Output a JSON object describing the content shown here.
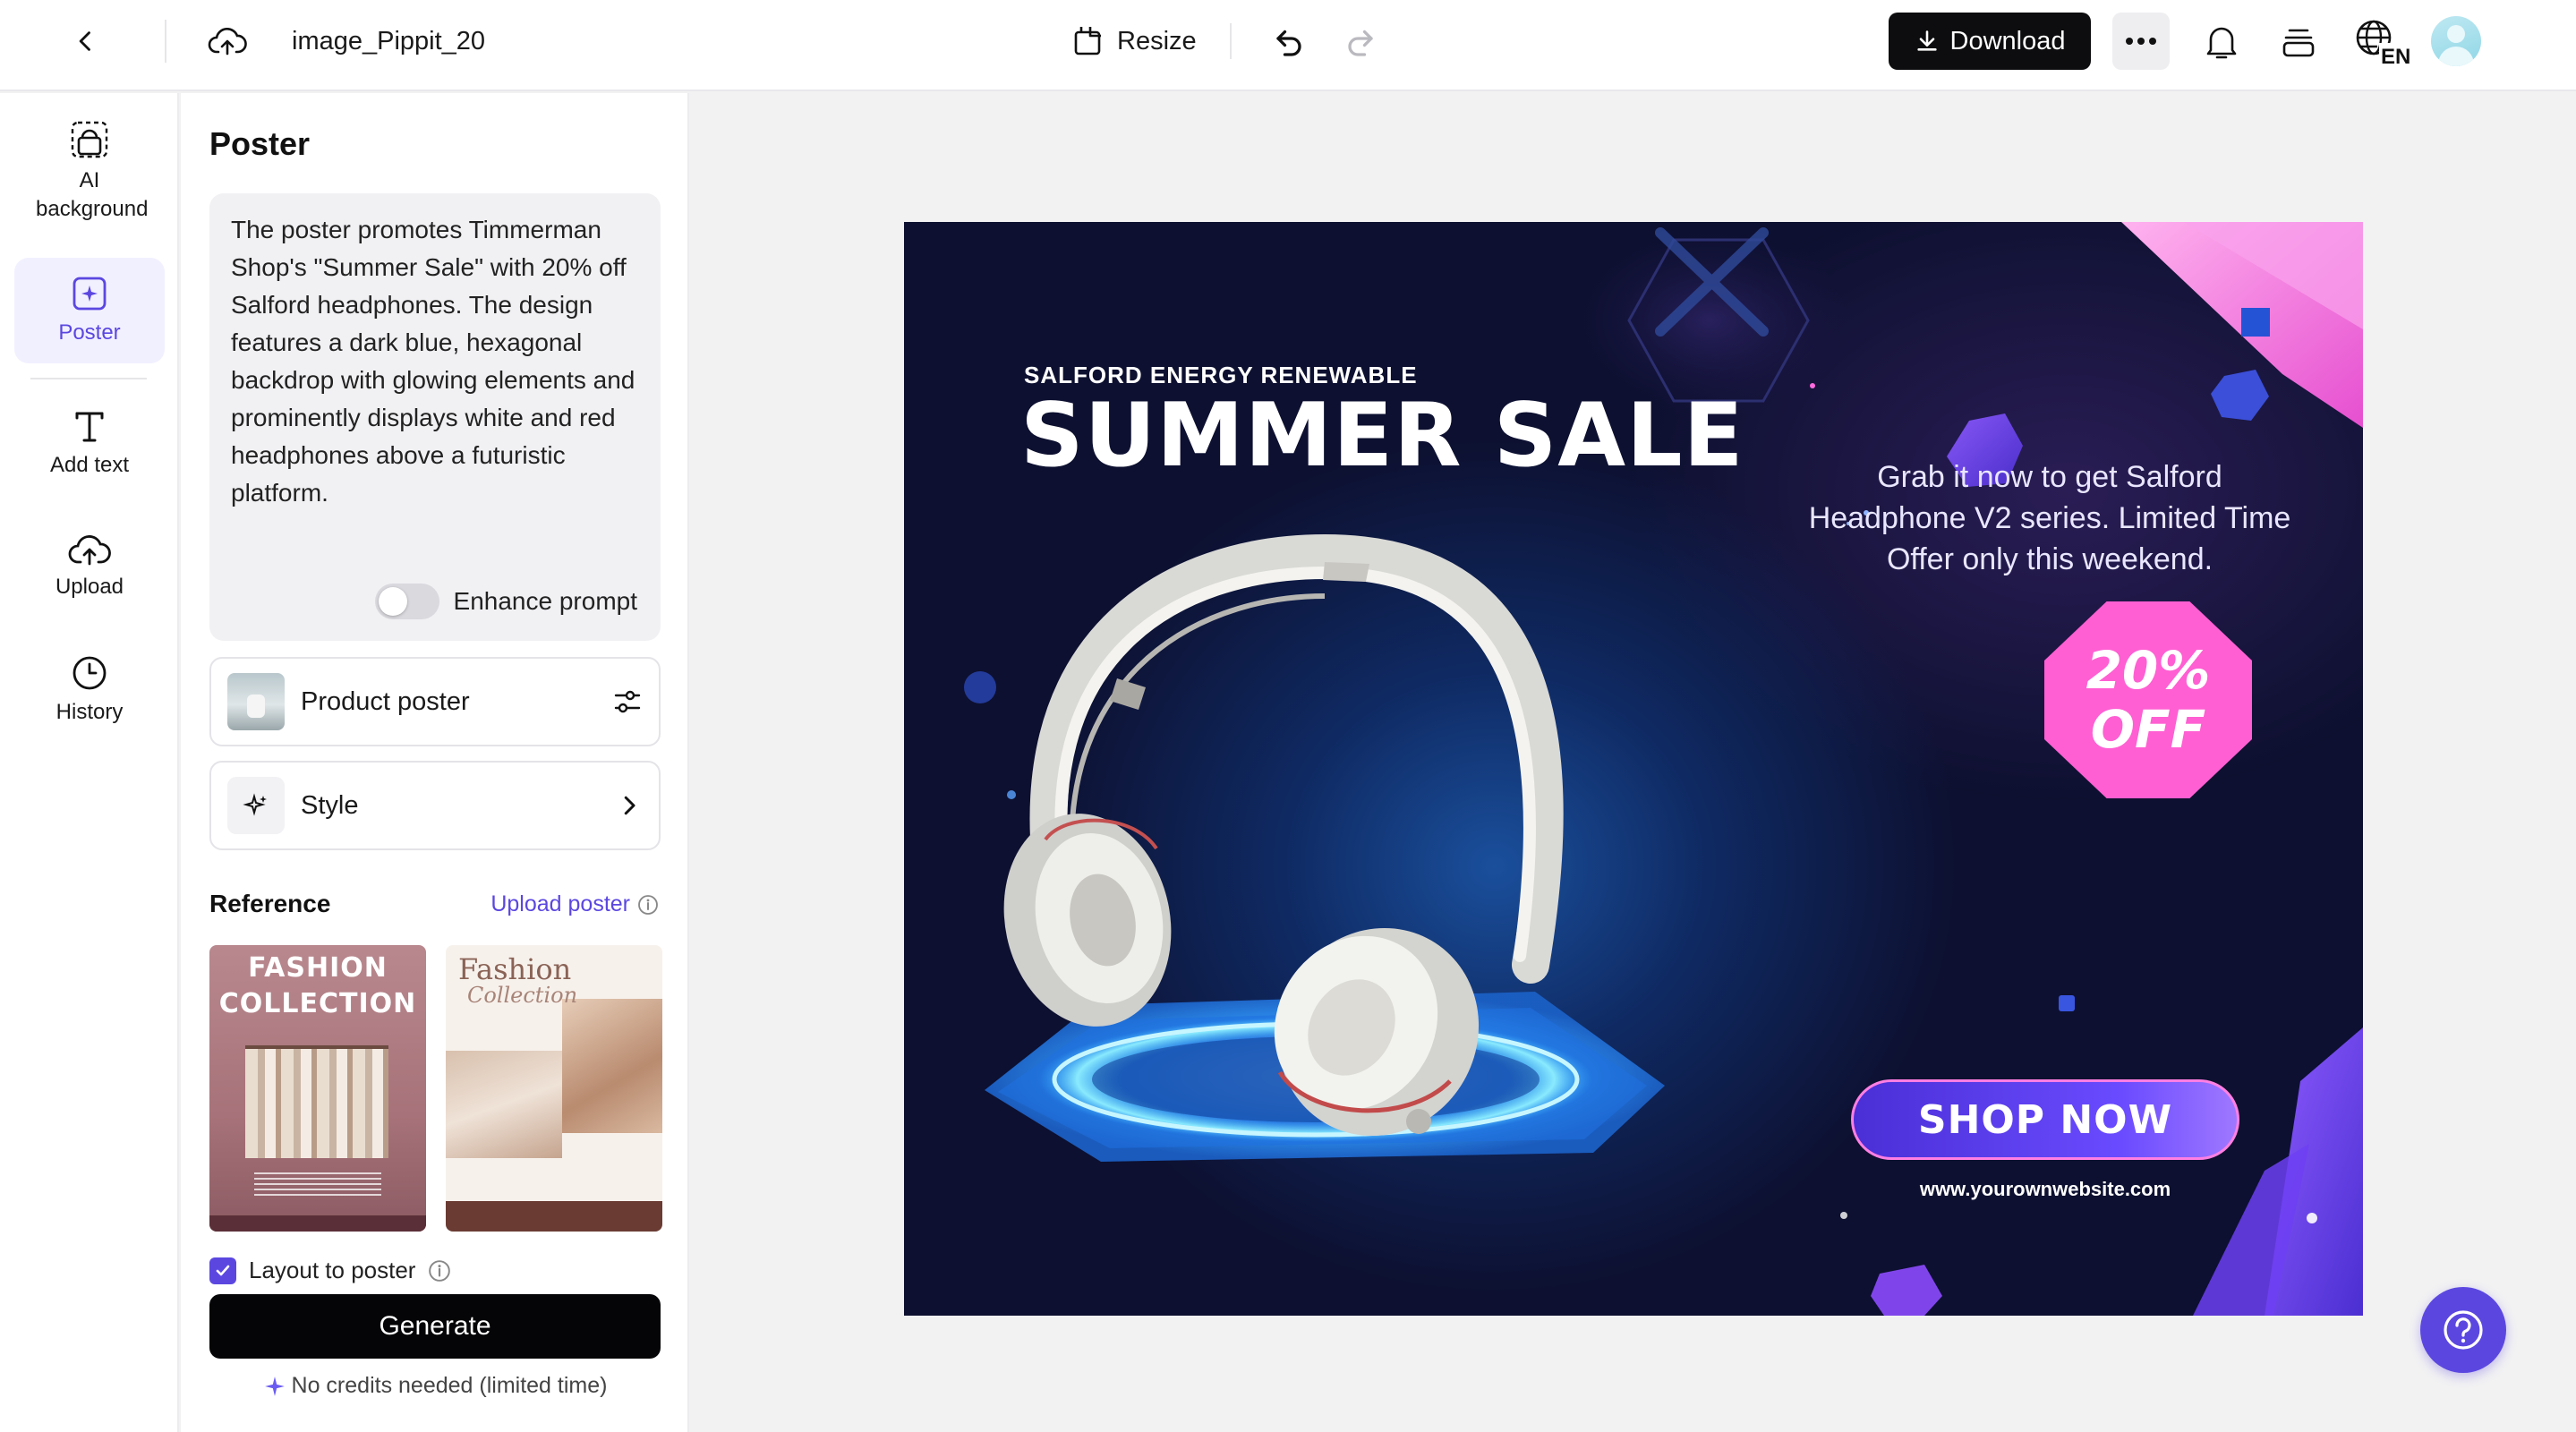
{
  "header": {
    "file_name": "image_Pippit_20",
    "resize_label": "Resize",
    "download_label": "Download",
    "language": "EN"
  },
  "rail": {
    "items": [
      {
        "label": "AI background",
        "icon": "ai-background-icon"
      },
      {
        "label": "Poster",
        "icon": "poster-icon",
        "active": true
      },
      {
        "label": "Add text",
        "icon": "text-icon"
      },
      {
        "label": "Upload",
        "icon": "upload-cloud-icon"
      },
      {
        "label": "History",
        "icon": "clock-icon"
      }
    ]
  },
  "panel": {
    "title": "Poster",
    "prompt": "The poster promotes Timmerman Shop's \"Summer Sale\" with 20% off Salford headphones. The design features a dark blue, hexagonal backdrop with glowing elements and prominently displays white and red headphones above a futuristic platform.",
    "enhance_label": "Enhance prompt",
    "enhance_on": false,
    "product_poster_label": "Product poster",
    "style_label": "Style",
    "reference_label": "Reference",
    "upload_poster_label": "Upload poster",
    "reference_1": {
      "title": "FASHION COLLECTION"
    },
    "reference_2": {
      "title": "Fashion",
      "subtitle": "Collection"
    },
    "layout_label": "Layout to poster",
    "layout_checked": true,
    "generate_label": "Generate",
    "credits_note": "No credits needed (limited time)"
  },
  "poster": {
    "pretitle": "SALFORD ENERGY RENEWABLE",
    "title": "SUMMER SALE",
    "description": "Grab it now to get Salford Headphone V2 series. Limited Time Offer only this weekend.",
    "badge_line1": "20%",
    "badge_line2": "OFF",
    "cta": "SHOP NOW",
    "url": "www.yourownwebsite.com"
  },
  "colors": {
    "accent": "#5b47e0",
    "poster_bg": "#0d1030",
    "badge": "#ff5fd2"
  }
}
